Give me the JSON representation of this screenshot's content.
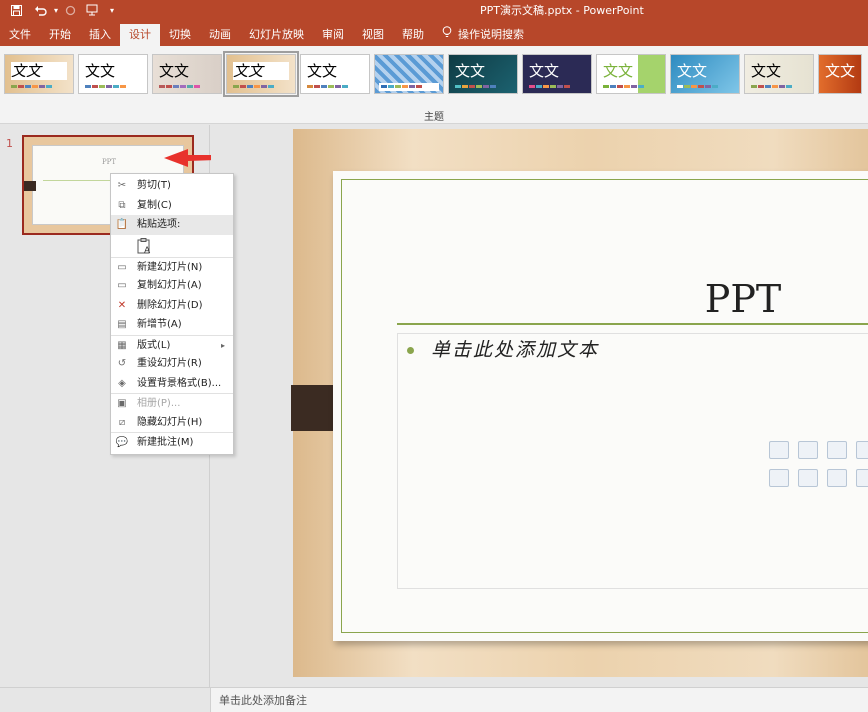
{
  "app": {
    "title": "PPT演示文稿.pptx  -  PowerPoint",
    "accent_color": "#b7472a"
  },
  "quick_access": [
    {
      "name": "save-icon"
    },
    {
      "name": "undo-icon"
    },
    {
      "name": "redo-icon"
    },
    {
      "name": "present-icon"
    }
  ],
  "tabs": [
    {
      "label": "文件"
    },
    {
      "label": "开始"
    },
    {
      "label": "插入"
    },
    {
      "label": "设计",
      "active": true
    },
    {
      "label": "切换"
    },
    {
      "label": "动画"
    },
    {
      "label": "幻灯片放映"
    },
    {
      "label": "审阅"
    },
    {
      "label": "视图"
    },
    {
      "label": "帮助"
    },
    {
      "label": "操作说明搜索"
    }
  ],
  "ribbon": {
    "group_label": "主题",
    "theme_sample_text": "文文"
  },
  "thumbnail": {
    "number": "1",
    "title": "PPT"
  },
  "context_menu": {
    "items": [
      {
        "label": "剪切(T)",
        "icon": "scissors-icon"
      },
      {
        "label": "复制(C)",
        "icon": "copy-icon"
      },
      {
        "label": "粘贴选项:",
        "icon": "paste-icon"
      },
      {
        "label": "新建幻灯片(N)",
        "icon": "new-slide-icon"
      },
      {
        "label": "复制幻灯片(A)",
        "icon": "duplicate-slide-icon"
      },
      {
        "label": "删除幻灯片(D)",
        "icon": "delete-slide-icon"
      },
      {
        "label": "新增节(A)",
        "icon": "add-section-icon"
      },
      {
        "label": "版式(L)",
        "icon": "layout-icon"
      },
      {
        "label": "重设幻灯片(R)",
        "icon": "reset-slide-icon"
      },
      {
        "label": "设置背景格式(B)...",
        "icon": "format-background-icon"
      },
      {
        "label": "相册(P)...",
        "icon": "photo-album-icon"
      },
      {
        "label": "隐藏幻灯片(H)",
        "icon": "hide-slide-icon"
      },
      {
        "label": "新建批注(M)",
        "icon": "new-comment-icon"
      }
    ]
  },
  "slide": {
    "title": "PPT",
    "body_placeholder": "单击此处添加文本"
  },
  "notes": {
    "placeholder": "单击此处添加备注"
  }
}
